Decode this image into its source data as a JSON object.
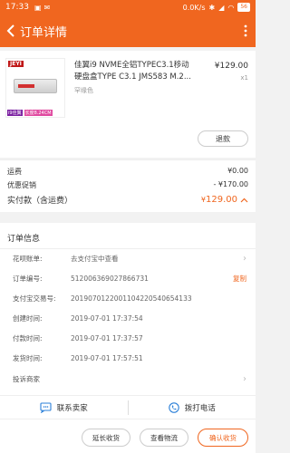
{
  "status_bar": {
    "time": "17:33",
    "network_speed": "0.0K/s",
    "battery": "56"
  },
  "header": {
    "title": "订单详情"
  },
  "product": {
    "thumb_brand": "JEYI",
    "thumb_tag1": "i9佳翼",
    "thumb_tag2": "长度8.24CM",
    "name_line1": "佳翼i9 NVME全铝TYPEC3.1移动",
    "name_line2": "硬盘盒TYPE C3.1 JMS583 M.2...",
    "variant": "罕缘色",
    "price": "¥129.00",
    "quantity": "x1",
    "refund_label": "退款"
  },
  "totals": {
    "shipping_label": "运费",
    "shipping_value": "¥0.00",
    "discount_label": "优惠促销",
    "discount_value": "- ¥170.00",
    "paid_label": "实付款（含运费）",
    "paid_currency": "¥",
    "paid_value": "129.00"
  },
  "order_info": {
    "heading": "订单信息",
    "rows": [
      {
        "label": "花呗账单:",
        "value": "去支付宝中查看"
      },
      {
        "label": "订单编号:",
        "value": "512006369027866731",
        "action": "复制"
      },
      {
        "label": "支付宝交易号:",
        "value": "2019070122001104220540654133"
      },
      {
        "label": "创建时间:",
        "value": "2019-07-01 17:37:54"
      },
      {
        "label": "付款时间:",
        "value": "2019-07-01 17:37:57"
      },
      {
        "label": "发货时间:",
        "value": "2019-07-01 17:57:51"
      },
      {
        "label": "投诉商家",
        "value": ""
      }
    ]
  },
  "contact": {
    "seller_label": "联系卖家",
    "phone_label": "拨打电话"
  },
  "actions": {
    "extend_label": "延长收货",
    "logistics_label": "查看物流",
    "confirm_label": "确认收货"
  },
  "colors": {
    "accent": "#f0661f"
  }
}
